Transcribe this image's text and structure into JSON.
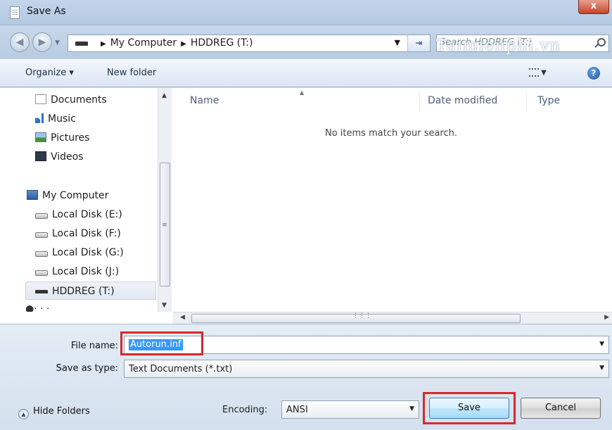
{
  "window": {
    "title": "Save As",
    "close_glyph": "x"
  },
  "watermark": "Taimienphi.vn",
  "address_bar": {
    "breadcrumbs": [
      "My Computer",
      "HDDREG (T:)"
    ],
    "search_placeholder": "Search HDDREG (T:)"
  },
  "toolbar": {
    "organize": "Organize ▾",
    "new_folder": "New folder"
  },
  "sidebar": {
    "items": [
      {
        "label": "Documents",
        "icon": "documents-icon"
      },
      {
        "label": "Music",
        "icon": "music-icon"
      },
      {
        "label": "Pictures",
        "icon": "pictures-icon"
      },
      {
        "label": "Videos",
        "icon": "videos-icon"
      },
      {
        "label": "My Computer",
        "icon": "computer-icon"
      },
      {
        "label": "Local Disk (E:)",
        "icon": "disk-icon"
      },
      {
        "label": "Local Disk (F:)",
        "icon": "disk-icon"
      },
      {
        "label": "Local Disk (G:)",
        "icon": "disk-icon"
      },
      {
        "label": "Local Disk (J:)",
        "icon": "disk-icon"
      },
      {
        "label": "HDDREG (T:)",
        "icon": "drive-icon",
        "selected": true
      }
    ]
  },
  "file_list": {
    "columns": [
      "Name",
      "Date modified",
      "Type"
    ],
    "empty_message": "No items match your search."
  },
  "form": {
    "file_name_label": "File name:",
    "file_name_value": "Autorun.inf",
    "save_as_type_label": "Save as type:",
    "save_as_type_value": "Text Documents (*.txt)",
    "encoding_label": "Encoding:",
    "encoding_value": "ANSI",
    "hide_folders": "Hide Folders",
    "save": "Save",
    "cancel": "Cancel"
  },
  "colors": {
    "highlight_red": "#d62a2a",
    "selection_blue": "#3399ff"
  }
}
